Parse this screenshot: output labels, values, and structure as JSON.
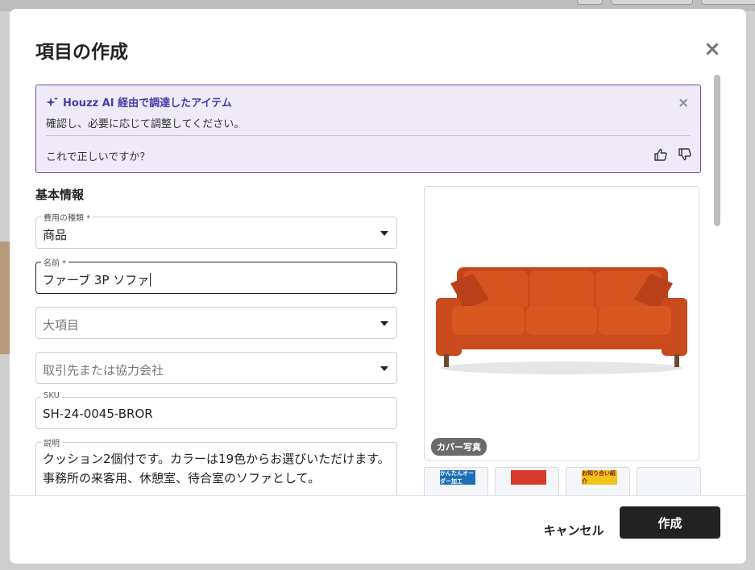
{
  "modal": {
    "title": "項目の作成",
    "close_icon": "close-icon"
  },
  "ai_notice": {
    "title": "Houzz AI 経由で調達したアイテム",
    "subtitle": "確認し、必要に応じて調整してください。",
    "question": "これで正しいですか？",
    "accent_color": "#4a3aa8",
    "background_color": "#efeaf7"
  },
  "form": {
    "section_title": "基本情報",
    "fields": {
      "expense_type": {
        "label": "費用の種類 *",
        "value": "商品"
      },
      "name": {
        "label": "名前 *",
        "value": "ファーブ 3P ソファ"
      },
      "category": {
        "placeholder": "大項目"
      },
      "vendor": {
        "placeholder": "取引先または協力会社"
      },
      "sku": {
        "label": "SKU",
        "value": "SH-24-0045-BROR"
      },
      "description": {
        "label": "説明",
        "value": "クッション2個付です。カラーは19色からお選びいただけます。事務所の来客用、休憩室、待合室のソファとして。"
      }
    }
  },
  "gallery": {
    "cover_badge": "カバー写真",
    "thumbnails": [
      {
        "caption": "かんたんオーダー加工",
        "color": "#1f6fb5"
      },
      {
        "caption": "",
        "color": "#d43b2a"
      },
      {
        "caption": "お知り合い紹介",
        "color": "#f2c31b"
      },
      {
        "caption": "",
        "color": "#eef2f8"
      }
    ]
  },
  "footer": {
    "cancel_label": "キャンセル",
    "create_label": "作成",
    "primary_color": "#222222"
  }
}
